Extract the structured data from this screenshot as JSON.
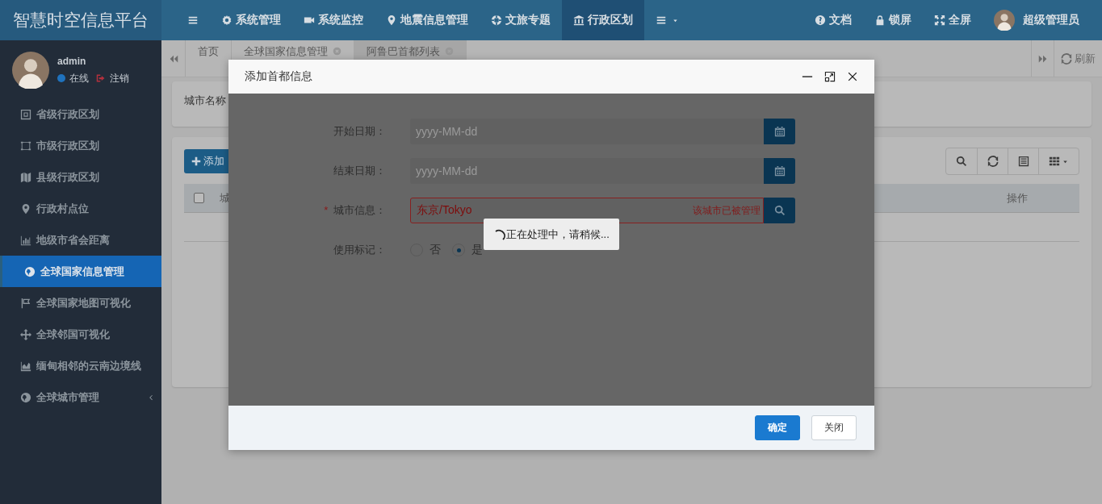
{
  "header": {
    "title": "智慧时空信息平台",
    "nav": [
      {
        "label": "系统管理",
        "selected": false
      },
      {
        "label": "系统监控",
        "selected": false
      },
      {
        "label": "地震信息管理",
        "selected": false
      },
      {
        "label": "文旅专题",
        "selected": false
      },
      {
        "label": "行政区划",
        "selected": true
      }
    ],
    "tools": [
      {
        "label": "文档"
      },
      {
        "label": "锁屏"
      },
      {
        "label": "全屏"
      }
    ],
    "user": "超级管理员"
  },
  "sidebar": {
    "user": {
      "name": "admin",
      "status": "在线",
      "logout": "注销"
    },
    "items": [
      {
        "label": "省级行政区划",
        "selected": false,
        "expandable": false
      },
      {
        "label": "市级行政区划",
        "selected": false,
        "expandable": false
      },
      {
        "label": "县级行政区划",
        "selected": false,
        "expandable": false
      },
      {
        "label": "行政村点位",
        "selected": false,
        "expandable": false
      },
      {
        "label": "地级市省会距离",
        "selected": false,
        "expandable": false
      },
      {
        "label": "全球国家信息管理",
        "selected": true,
        "expandable": false
      },
      {
        "label": "全球国家地图可视化",
        "selected": false,
        "expandable": false
      },
      {
        "label": "全球邻国可视化",
        "selected": false,
        "expandable": false
      },
      {
        "label": "缅甸相邻的云南边境线",
        "selected": false,
        "expandable": false
      },
      {
        "label": "全球城市管理",
        "selected": false,
        "expandable": true
      }
    ]
  },
  "tabs": [
    {
      "label": "首页",
      "selected": false,
      "closable": false
    },
    {
      "label": "全球国家信息管理",
      "selected": false,
      "closable": true
    },
    {
      "label": "阿鲁巴首都列表",
      "selected": true,
      "closable": true
    }
  ],
  "refresh": "刷新",
  "search_panel": {
    "label": "城市名称"
  },
  "table": {
    "add_button": "添加",
    "select_all_checked": false,
    "columns": [
      {
        "label": "城"
      },
      {
        "label": "操作"
      }
    ]
  },
  "dialog": {
    "title": "添加首都信息",
    "fields": [
      {
        "kind": "date",
        "label": "开始日期：",
        "placeholder": "yyyy-MM-dd"
      },
      {
        "kind": "date",
        "label": "结束日期：",
        "placeholder": "yyyy-MM-dd"
      },
      {
        "kind": "lookup",
        "label": "城市信息：",
        "required_mark": "*",
        "value": "东京/Tokyo",
        "error": "该城市已被管理"
      },
      {
        "kind": "radio",
        "label": "使用标记：",
        "options": [
          {
            "label": "否",
            "selected": false
          },
          {
            "label": "是",
            "selected": true
          }
        ]
      }
    ],
    "buttons": [
      {
        "label": "确定",
        "kind": "primary"
      },
      {
        "label": "关闭",
        "kind": "default"
      }
    ]
  },
  "loading": {
    "text": "正在处理中，请稍候..."
  }
}
